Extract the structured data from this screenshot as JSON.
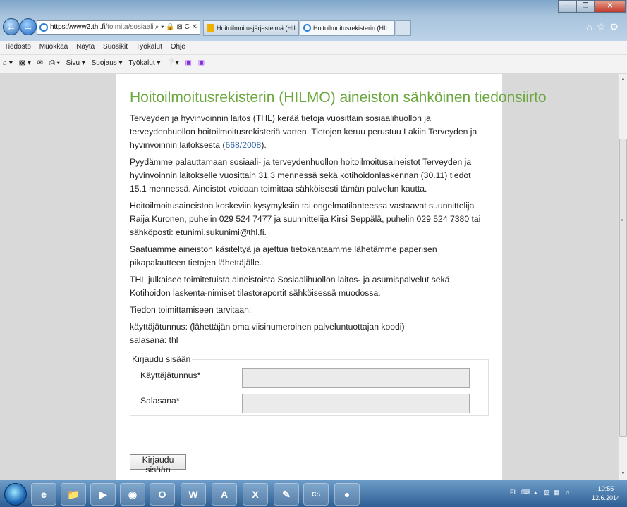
{
  "browser": {
    "address": {
      "host": "https://www2.thl.fi",
      "path": "/toimita/sosiaalihilm"
    },
    "address_controls": "⌕ ▾ 🔒 ⊠ C ✕",
    "tabs": [
      {
        "label": "Hoitoilmoitusjärjestelmä (HIL..."
      },
      {
        "label": "Hoitoilmoitusrekisterin (HIL...",
        "close": "✕"
      }
    ],
    "menu": [
      "Tiedosto",
      "Muokkaa",
      "Näytä",
      "Suosikit",
      "Työkalut",
      "Ohje"
    ],
    "commands": [
      "Sivu ▾",
      "Suojaus ▾",
      "Työkalut ▾"
    ]
  },
  "page": {
    "title": "Hoitoilmoitusrekisterin (HILMO) aineiston sähköinen tiedonsiirto",
    "p1_a": "Terveyden ja hyvinvoinnin laitos (THL) kerää tietoja vuosittain sosiaalihuollon ja terveydenhuollon hoitoilmoitusrekisteriä varten. Tietojen keruu perustuu Lakiin Terveyden ja hyvinvoinnin laitoksesta (",
    "p1_link": "668/2008",
    "p1_b": ").",
    "p2": "Pyydämme palauttamaan sosiaali- ja terveydenhuollon hoitoilmoitusaineistot Terveyden ja hyvinvoinnin laitokselle vuosittain 31.3 mennessä sekä kotihoidonlaskennan (30.11) tiedot 15.1 mennessä. Aineistot voidaan toimittaa sähköisesti tämän palvelun kautta.",
    "p3": "Hoitoilmoitusaineistoa koskeviin kysymyksiin tai ongelmatilanteessa vastaavat suunnittelija Raija Kuronen, puhelin 029 524 7477 ja suunnittelija Kirsi Seppälä, puhelin 029 524 7380 tai sähköposti: etunimi.sukunimi@thl.fi.",
    "p4": "Saatuamme aineiston käsiteltyä ja ajettua tietokantaamme lähetämme paperisen pikapalautteen tietojen lähettäjälle.",
    "p5": "THL julkaisee toimitetuista aineistoista Sosiaalihuollon laitos- ja asumispalvelut sekä Kotihoidon laskenta-nimiset tilastoraportit sähköisessä muodossa.",
    "p6": "Tiedon toimittamiseen tarvitaan:",
    "p7_line1": "käyttäjätunnus: (lähettäjän oma viisinumeroinen palveluntuottajan koodi)",
    "p7_line2": "salasana: thl"
  },
  "login": {
    "legend": "Kirjaudu sisään",
    "username_label": "Käyttäjätunnus*",
    "password_label": "Salasana*",
    "submit_label": "Kirjaudu sisään"
  },
  "taskbar": {
    "apps": [
      "W",
      "X",
      "C:\\"
    ],
    "tray_lang": "FI",
    "time": "10:55",
    "date": "12.6.2014"
  }
}
